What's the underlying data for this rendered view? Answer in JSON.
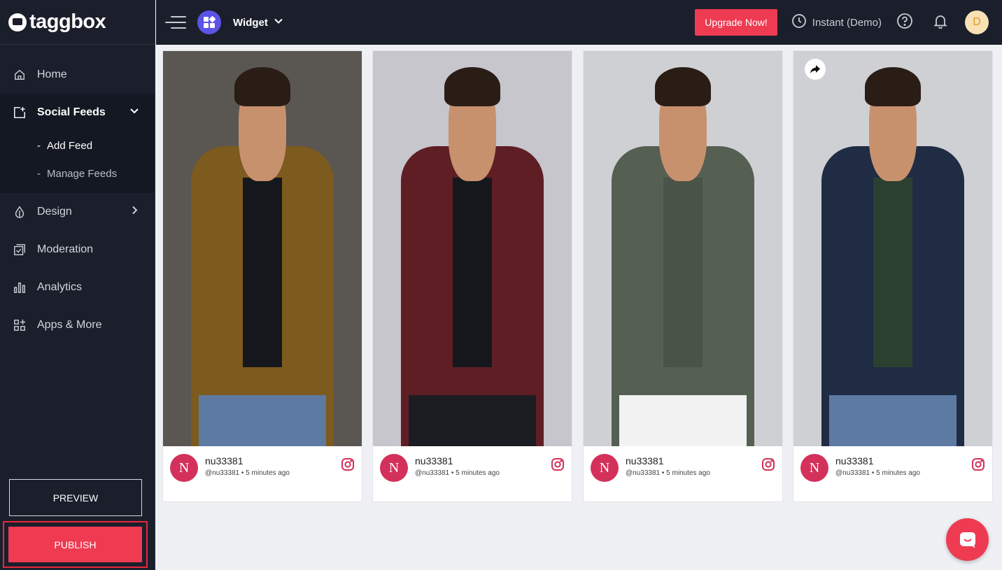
{
  "brand": {
    "logo_text": "taggbox"
  },
  "sidebar": {
    "items": [
      {
        "label": "Home",
        "icon": "home-icon"
      },
      {
        "label": "Social Feeds",
        "icon": "add-feed-icon",
        "expanded": true,
        "subitems": [
          {
            "label": "Add Feed"
          },
          {
            "label": "Manage Feeds"
          }
        ]
      },
      {
        "label": "Design",
        "icon": "design-drop-icon"
      },
      {
        "label": "Moderation",
        "icon": "moderation-icon"
      },
      {
        "label": "Analytics",
        "icon": "analytics-icon"
      },
      {
        "label": "Apps & More",
        "icon": "apps-icon"
      }
    ],
    "preview_label": "PREVIEW",
    "publish_label": "PUBLISH"
  },
  "topbar": {
    "widget_label": "Widget",
    "upgrade_label": "Upgrade Now!",
    "instant_label": "Instant (Demo)",
    "avatar_initial": "D"
  },
  "colors": {
    "accent": "#ee3b52",
    "sidebar_bg": "#1b1f2b",
    "widget_icon": "#5b54e6",
    "instagram": "#d3315b"
  },
  "posts": [
    {
      "avatar_initial": "N",
      "username": "nu33381",
      "handle": "@nu33381",
      "time": "5 minutes ago",
      "platform": "instagram-icon",
      "jacket_color": "#7d5a1e",
      "bg_color": "#5a5652"
    },
    {
      "avatar_initial": "N",
      "username": "nu33381",
      "handle": "@nu33381",
      "time": "5 minutes ago",
      "platform": "instagram-icon",
      "jacket_color": "#5e1e24",
      "bg_color": "#c6c6cc"
    },
    {
      "avatar_initial": "N",
      "username": "nu33381",
      "handle": "@nu33381",
      "time": "5 minutes ago",
      "platform": "instagram-icon",
      "jacket_color": "#555f52",
      "bg_color": "#cfd0d4"
    },
    {
      "avatar_initial": "N",
      "username": "nu33381",
      "handle": "@nu33381",
      "time": "5 minutes ago",
      "platform": "instagram-icon",
      "jacket_color": "#1f2c44",
      "bg_color": "#cfd0d4"
    }
  ]
}
